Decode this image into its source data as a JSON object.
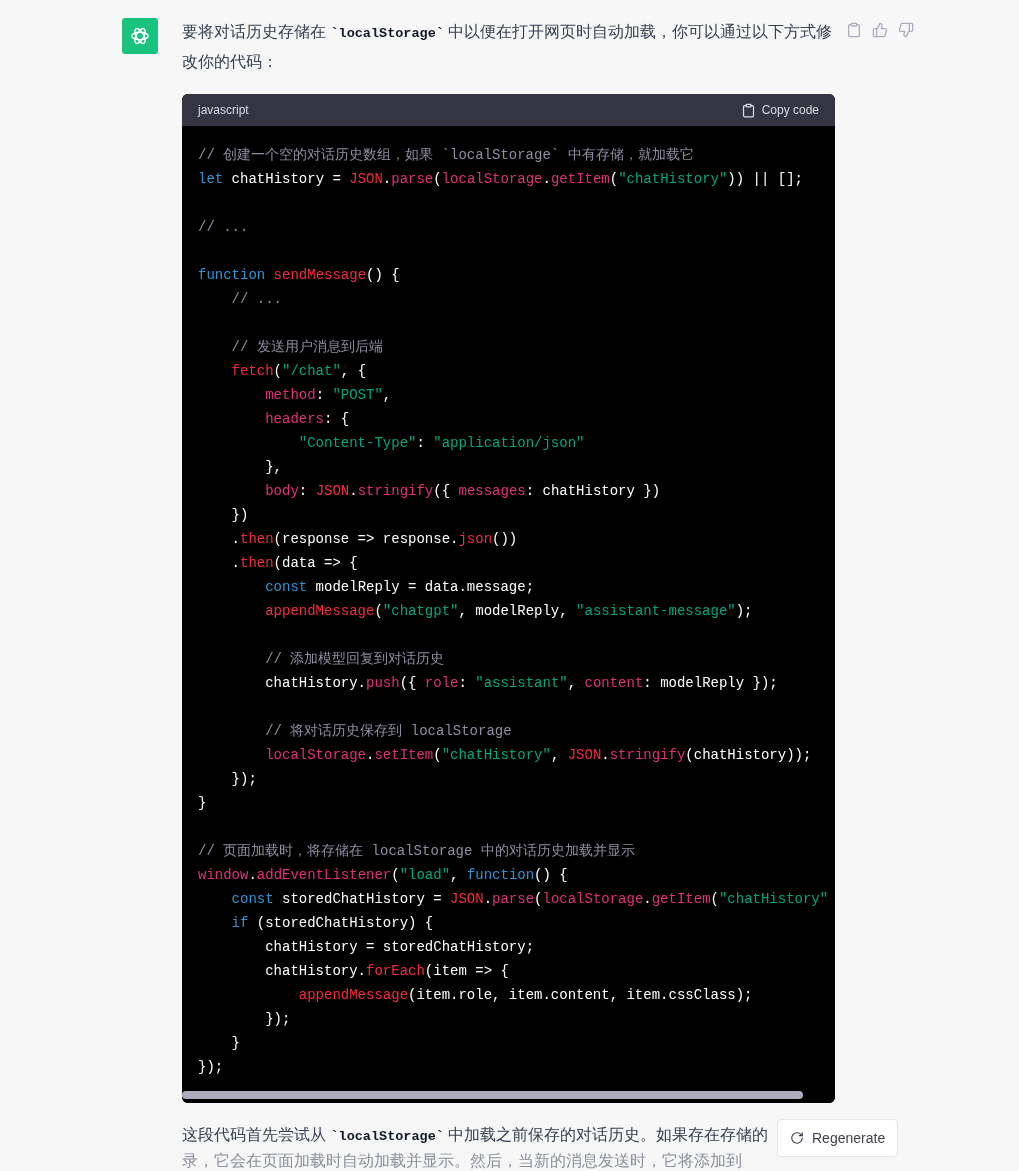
{
  "message": {
    "intro": [
      {
        "kind": "text",
        "text": "要将对话历史存储在 "
      },
      {
        "kind": "code",
        "text": "`localStorage`"
      },
      {
        "kind": "text",
        "text": " 中以便在打开网页时自动加载，你可以通过以下方式修改你的代码："
      }
    ],
    "code_block": {
      "language": "javascript",
      "copy_label": "Copy code",
      "lines": [
        {
          "kind": "code",
          "tokens": [
            {
              "kind": "comment",
              "text": "// 创建一个空的对话历史数组，如果 `localStorage` 中有存储，就加载它"
            }
          ]
        },
        {
          "kind": "code",
          "tokens": [
            {
              "kind": "keyword",
              "text": "let"
            },
            {
              "kind": "plain",
              "text": " chatHistory = "
            },
            {
              "kind": "func",
              "text": "JSON"
            },
            {
              "kind": "plain",
              "text": "."
            },
            {
              "kind": "prop",
              "text": "parse"
            },
            {
              "kind": "plain",
              "text": "("
            },
            {
              "kind": "prop",
              "text": "localStorage"
            },
            {
              "kind": "plain",
              "text": "."
            },
            {
              "kind": "prop",
              "text": "getItem"
            },
            {
              "kind": "plain",
              "text": "("
            },
            {
              "kind": "string",
              "text": "\"chatHistory\""
            },
            {
              "kind": "plain",
              "text": ")) || [];"
            }
          ]
        },
        {
          "kind": "blank"
        },
        {
          "kind": "code",
          "tokens": [
            {
              "kind": "comment",
              "text": "// ..."
            }
          ]
        },
        {
          "kind": "blank"
        },
        {
          "kind": "code",
          "tokens": [
            {
              "kind": "keyword",
              "text": "function"
            },
            {
              "kind": "func",
              "text": " sendMessage"
            },
            {
              "kind": "plain",
              "text": "() {"
            }
          ]
        },
        {
          "kind": "code",
          "tokens": [
            {
              "kind": "comment",
              "text": "    // ..."
            }
          ]
        },
        {
          "kind": "blank"
        },
        {
          "kind": "code",
          "tokens": [
            {
              "kind": "comment",
              "text": "    // 发送用户消息到后端"
            }
          ]
        },
        {
          "kind": "code",
          "tokens": [
            {
              "kind": "func",
              "text": "    fetch"
            },
            {
              "kind": "plain",
              "text": "("
            },
            {
              "kind": "string",
              "text": "\"/chat\""
            },
            {
              "kind": "plain",
              "text": ", {"
            }
          ]
        },
        {
          "kind": "code",
          "tokens": [
            {
              "kind": "prop",
              "text": "        method"
            },
            {
              "kind": "plain",
              "text": ": "
            },
            {
              "kind": "string",
              "text": "\"POST\""
            },
            {
              "kind": "plain",
              "text": ","
            }
          ]
        },
        {
          "kind": "code",
          "tokens": [
            {
              "kind": "prop",
              "text": "        headers"
            },
            {
              "kind": "plain",
              "text": ": {"
            }
          ]
        },
        {
          "kind": "code",
          "tokens": [
            {
              "kind": "string",
              "text": "            \"Content-Type\""
            },
            {
              "kind": "plain",
              "text": ": "
            },
            {
              "kind": "string",
              "text": "\"application/json\""
            }
          ]
        },
        {
          "kind": "code",
          "tokens": [
            {
              "kind": "plain",
              "text": "        },"
            }
          ]
        },
        {
          "kind": "code",
          "tokens": [
            {
              "kind": "prop",
              "text": "        body"
            },
            {
              "kind": "plain",
              "text": ": "
            },
            {
              "kind": "func",
              "text": "JSON"
            },
            {
              "kind": "plain",
              "text": "."
            },
            {
              "kind": "prop",
              "text": "stringify"
            },
            {
              "kind": "plain",
              "text": "({ "
            },
            {
              "kind": "prop",
              "text": "messages"
            },
            {
              "kind": "plain",
              "text": ": chatHistory })"
            }
          ]
        },
        {
          "kind": "code",
          "tokens": [
            {
              "kind": "plain",
              "text": "    })"
            }
          ]
        },
        {
          "kind": "code",
          "tokens": [
            {
              "kind": "plain",
              "text": "    ."
            },
            {
              "kind": "func",
              "text": "then"
            },
            {
              "kind": "plain",
              "text": "(response => response."
            },
            {
              "kind": "func",
              "text": "json"
            },
            {
              "kind": "plain",
              "text": "())"
            }
          ]
        },
        {
          "kind": "code",
          "tokens": [
            {
              "kind": "plain",
              "text": "    ."
            },
            {
              "kind": "func",
              "text": "then"
            },
            {
              "kind": "plain",
              "text": "(data => {"
            }
          ]
        },
        {
          "kind": "code",
          "tokens": [
            {
              "kind": "keyword",
              "text": "        const"
            },
            {
              "kind": "plain",
              "text": " modelReply = data.message;"
            }
          ]
        },
        {
          "kind": "code",
          "tokens": [
            {
              "kind": "func",
              "text": "        appendMessage"
            },
            {
              "kind": "plain",
              "text": "("
            },
            {
              "kind": "string",
              "text": "\"chatgpt\""
            },
            {
              "kind": "plain",
              "text": ", modelReply, "
            },
            {
              "kind": "string",
              "text": "\"assistant-message\""
            },
            {
              "kind": "plain",
              "text": ");"
            }
          ]
        },
        {
          "kind": "blank"
        },
        {
          "kind": "code",
          "tokens": [
            {
              "kind": "comment",
              "text": "        // 添加模型回复到对话历史"
            }
          ]
        },
        {
          "kind": "code",
          "tokens": [
            {
              "kind": "plain",
              "text": "        chatHistory."
            },
            {
              "kind": "prop",
              "text": "push"
            },
            {
              "kind": "plain",
              "text": "({ "
            },
            {
              "kind": "prop",
              "text": "role"
            },
            {
              "kind": "plain",
              "text": ": "
            },
            {
              "kind": "string",
              "text": "\"assistant\""
            },
            {
              "kind": "plain",
              "text": ", "
            },
            {
              "kind": "prop",
              "text": "content"
            },
            {
              "kind": "plain",
              "text": ": modelReply });"
            }
          ]
        },
        {
          "kind": "blank"
        },
        {
          "kind": "code",
          "tokens": [
            {
              "kind": "comment",
              "text": "        // 将对话历史保存到 localStorage"
            }
          ]
        },
        {
          "kind": "code",
          "tokens": [
            {
              "kind": "prop",
              "text": "        localStorage"
            },
            {
              "kind": "plain",
              "text": "."
            },
            {
              "kind": "prop",
              "text": "setItem"
            },
            {
              "kind": "plain",
              "text": "("
            },
            {
              "kind": "string",
              "text": "\"chatHistory\""
            },
            {
              "kind": "plain",
              "text": ", "
            },
            {
              "kind": "func",
              "text": "JSON"
            },
            {
              "kind": "plain",
              "text": "."
            },
            {
              "kind": "prop",
              "text": "stringify"
            },
            {
              "kind": "plain",
              "text": "(chatHistory));"
            }
          ]
        },
        {
          "kind": "code",
          "tokens": [
            {
              "kind": "plain",
              "text": "    });"
            }
          ]
        },
        {
          "kind": "code",
          "tokens": [
            {
              "kind": "plain",
              "text": "}"
            }
          ]
        },
        {
          "kind": "blank"
        },
        {
          "kind": "code",
          "tokens": [
            {
              "kind": "comment",
              "text": "// 页面加载时，将存储在 localStorage 中的对话历史加载并显示"
            }
          ]
        },
        {
          "kind": "code",
          "tokens": [
            {
              "kind": "prop",
              "text": "window"
            },
            {
              "kind": "plain",
              "text": "."
            },
            {
              "kind": "prop",
              "text": "addEventListener"
            },
            {
              "kind": "plain",
              "text": "("
            },
            {
              "kind": "string",
              "text": "\"load\""
            },
            {
              "kind": "plain",
              "text": ", "
            },
            {
              "kind": "keyword",
              "text": "function"
            },
            {
              "kind": "plain",
              "text": "() {"
            }
          ]
        },
        {
          "kind": "code",
          "tokens": [
            {
              "kind": "keyword",
              "text": "    const"
            },
            {
              "kind": "plain",
              "text": " storedChatHistory = "
            },
            {
              "kind": "func",
              "text": "JSON"
            },
            {
              "kind": "plain",
              "text": "."
            },
            {
              "kind": "prop",
              "text": "parse"
            },
            {
              "kind": "plain",
              "text": "("
            },
            {
              "kind": "prop",
              "text": "localStorage"
            },
            {
              "kind": "plain",
              "text": "."
            },
            {
              "kind": "prop",
              "text": "getItem"
            },
            {
              "kind": "plain",
              "text": "("
            },
            {
              "kind": "string",
              "text": "\"chatHistory\""
            }
          ]
        },
        {
          "kind": "code",
          "tokens": [
            {
              "kind": "keyword",
              "text": "    if"
            },
            {
              "kind": "plain",
              "text": " (storedChatHistory) {"
            }
          ]
        },
        {
          "kind": "code",
          "tokens": [
            {
              "kind": "plain",
              "text": "        chatHistory = storedChatHistory;"
            }
          ]
        },
        {
          "kind": "code",
          "tokens": [
            {
              "kind": "plain",
              "text": "        chatHistory."
            },
            {
              "kind": "func",
              "text": "forEach"
            },
            {
              "kind": "plain",
              "text": "(item => {"
            }
          ]
        },
        {
          "kind": "code",
          "tokens": [
            {
              "kind": "func",
              "text": "            appendMessage"
            },
            {
              "kind": "plain",
              "text": "(item.role, item.content, item.cssClass);"
            }
          ]
        },
        {
          "kind": "code",
          "tokens": [
            {
              "kind": "plain",
              "text": "        });"
            }
          ]
        },
        {
          "kind": "code",
          "tokens": [
            {
              "kind": "plain",
              "text": "    }"
            }
          ]
        },
        {
          "kind": "code",
          "tokens": [
            {
              "kind": "plain",
              "text": "});"
            }
          ]
        }
      ]
    },
    "outro_lines": [
      [
        {
          "kind": "text",
          "text": "这段代码首先尝试从 "
        },
        {
          "kind": "code",
          "text": "`localStorage`"
        },
        {
          "kind": "text",
          "text": " 中加载之前保存的对话历史。如果存在存储的"
        }
      ],
      [
        {
          "kind": "text",
          "text": "录，它会在页面加载时自动加载并显示。然后，当新的消息发送时，它将添加到"
        }
      ]
    ]
  },
  "regenerate_button": {
    "label": "Regenerate"
  }
}
